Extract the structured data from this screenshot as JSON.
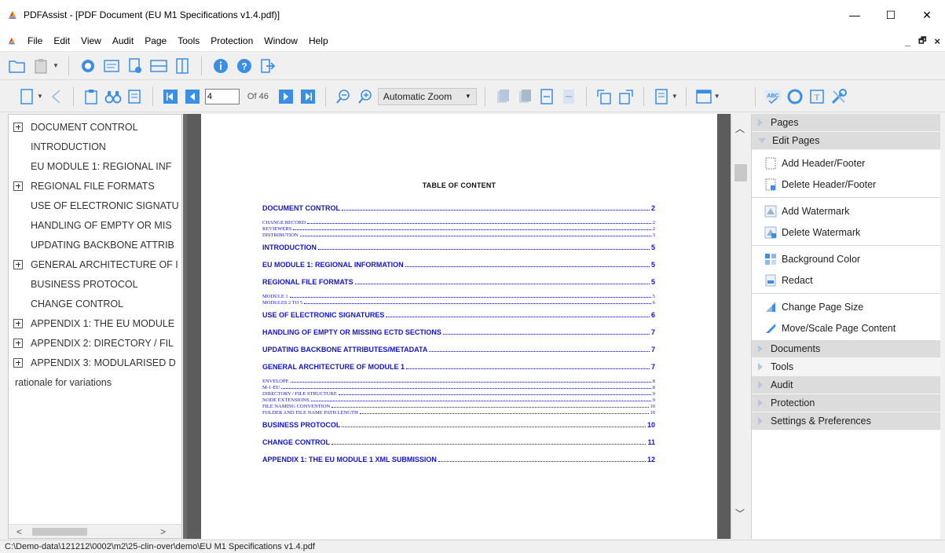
{
  "window": {
    "title": "PDFAssist - [PDF Document (EU M1 Specifications v1.4.pdf)]",
    "minimize": "—",
    "maximize": "☐",
    "close": "✕"
  },
  "menu": {
    "items": [
      "File",
      "Edit",
      "View",
      "Audit",
      "Page",
      "Tools",
      "Protection",
      "Window",
      "Help"
    ],
    "mdi_min": "_",
    "mdi_restore": "🗗",
    "mdi_close": "×"
  },
  "navigation": {
    "current_page": "4",
    "page_count_label": "Of 46",
    "zoom": "Automatic Zoom"
  },
  "bookmarks": [
    {
      "label": "DOCUMENT CONTROL",
      "expandable": true
    },
    {
      "label": "INTRODUCTION",
      "expandable": false
    },
    {
      "label": "EU MODULE 1: REGIONAL INF",
      "expandable": false
    },
    {
      "label": "REGIONAL FILE FORMATS",
      "expandable": true
    },
    {
      "label": "USE OF ELECTRONIC SIGNATU",
      "expandable": false
    },
    {
      "label": "HANDLING OF EMPTY OR MIS",
      "expandable": false
    },
    {
      "label": "UPDATING BACKBONE ATTRIB",
      "expandable": false
    },
    {
      "label": "GENERAL ARCHITECTURE OF I",
      "expandable": true
    },
    {
      "label": "BUSINESS PROTOCOL",
      "expandable": false
    },
    {
      "label": "CHANGE CONTROL",
      "expandable": false
    },
    {
      "label": "APPENDIX 1: THE EU MODULE",
      "expandable": true
    },
    {
      "label": "APPENDIX 2: DIRECTORY / FIL",
      "expandable": true
    },
    {
      "label": "APPENDIX 3: MODULARISED D",
      "expandable": true
    },
    {
      "label": "rationale for variations",
      "expandable": false
    }
  ],
  "bookmarks_scroll": {
    "left": "<",
    "right": ">"
  },
  "document": {
    "toc_title": "TABLE OF CONTENT",
    "entries": [
      {
        "type": "main",
        "label": "DOCUMENT CONTROL",
        "page": "2"
      },
      {
        "type": "sub",
        "label": "CHANGE RECORD",
        "page": "2"
      },
      {
        "type": "sub",
        "label": "REVIEWERS",
        "page": "2"
      },
      {
        "type": "sub",
        "label": "DISTRIBUTION",
        "page": "3"
      },
      {
        "type": "main",
        "label": "INTRODUCTION",
        "page": "5"
      },
      {
        "type": "main",
        "label": "EU MODULE 1: REGIONAL INFORMATION",
        "page": "5"
      },
      {
        "type": "main",
        "label": "REGIONAL FILE FORMATS",
        "page": "5"
      },
      {
        "type": "sub",
        "label": "MODULE 1",
        "page": "5"
      },
      {
        "type": "sub",
        "label": "MODULES 2 TO 5",
        "page": "6"
      },
      {
        "type": "main",
        "label": "USE OF ELECTRONIC SIGNATURES",
        "page": "6"
      },
      {
        "type": "main",
        "label": "HANDLING OF EMPTY OR MISSING ECTD SECTIONS",
        "page": "7"
      },
      {
        "type": "main",
        "label": "UPDATING BACKBONE ATTRIBUTES/METADATA",
        "page": "7"
      },
      {
        "type": "main",
        "label": "GENERAL ARCHITECTURE OF MODULE 1",
        "page": "7"
      },
      {
        "type": "sub",
        "label": "ENVELOPE",
        "page": "8"
      },
      {
        "type": "sub",
        "label": "M-1-EU",
        "page": "8"
      },
      {
        "type": "sub",
        "label": "DIRECTORY / FILE STRUCTURE",
        "page": "9"
      },
      {
        "type": "sub",
        "label": "NODE EXTENSIONS",
        "page": "9"
      },
      {
        "type": "sub",
        "label": "FILE NAMING CONVENTION",
        "page": "10"
      },
      {
        "type": "sub",
        "label": "FOLDER AND FILE NAME PATH LENGTH",
        "page": "10"
      },
      {
        "type": "main",
        "label": "BUSINESS PROTOCOL",
        "page": "10"
      },
      {
        "type": "main",
        "label": "CHANGE CONTROL",
        "page": "11"
      },
      {
        "type": "main",
        "label": "APPENDIX 1: THE EU MODULE 1 XML SUBMISSION",
        "page": "12"
      }
    ]
  },
  "scrollbar": {
    "up": "︿",
    "down": "﹀"
  },
  "right_panel": {
    "pages_header": "Pages",
    "edit_pages_header": "Edit Pages",
    "items": [
      {
        "label": "Add Header/Footer",
        "icon": "add-header-footer-icon"
      },
      {
        "label": "Delete Header/Footer",
        "icon": "delete-header-footer-icon"
      },
      {
        "label": "Add Watermark",
        "icon": "add-watermark-icon"
      },
      {
        "label": "Delete Watermark",
        "icon": "delete-watermark-icon"
      },
      {
        "label": "Background Color",
        "icon": "background-color-icon"
      },
      {
        "label": "Redact",
        "icon": "redact-icon"
      },
      {
        "label": "Change Page Size",
        "icon": "change-page-size-icon"
      },
      {
        "label": "Move/Scale Page Content",
        "icon": "move-scale-icon"
      }
    ],
    "sections": [
      "Documents",
      "Tools",
      "Audit",
      "Protection",
      "Settings & Preferences"
    ]
  },
  "status": {
    "path": "C:\\Demo-data\\121212\\0002\\m2\\25-clin-over\\demo\\EU M1 Specifications v1.4.pdf"
  },
  "colors": {
    "accent_blue": "#1515c8",
    "icon_blue": "#3a8ee6",
    "panel_header": "#dcdcdc"
  }
}
